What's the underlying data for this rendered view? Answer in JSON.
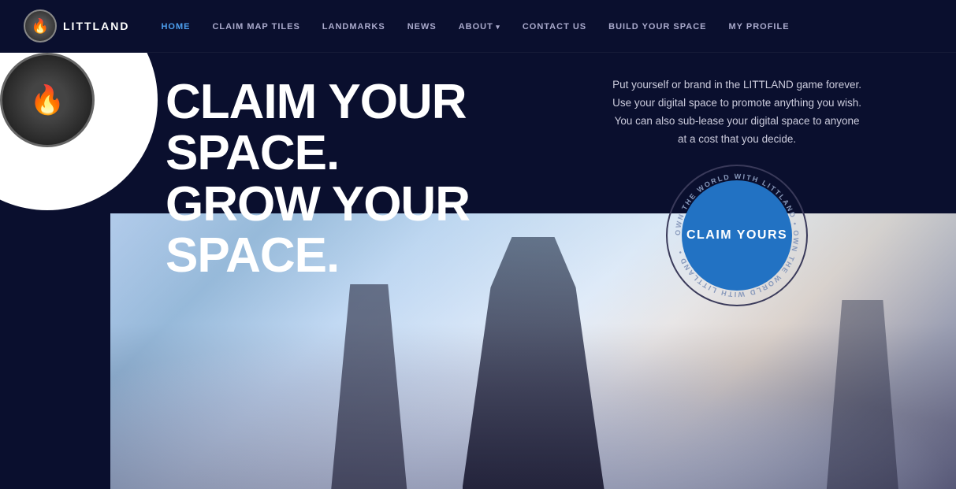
{
  "logo": {
    "text": "LITTLAND",
    "flame_icon": "🔥"
  },
  "nav": {
    "items": [
      {
        "label": "HOME",
        "active": true,
        "has_dropdown": false
      },
      {
        "label": "CLAIM MAP TILES",
        "active": false,
        "has_dropdown": false
      },
      {
        "label": "LANDMARKS",
        "active": false,
        "has_dropdown": false
      },
      {
        "label": "NEWS",
        "active": false,
        "has_dropdown": false
      },
      {
        "label": "ABOUT",
        "active": false,
        "has_dropdown": true
      },
      {
        "label": "CONTACT US",
        "active": false,
        "has_dropdown": false
      },
      {
        "label": "BUILD YOUR SPACE",
        "active": false,
        "has_dropdown": false
      },
      {
        "label": "MY PROFILE",
        "active": false,
        "has_dropdown": false
      }
    ]
  },
  "hero": {
    "headline_line1": "CLAIM YOUR SPACE.",
    "headline_line2": "GROW YOUR SPACE.",
    "description": "Put yourself or brand in the LITTLAND game forever. Use your digital space to promote anything you wish. You can also sub-lease your digital space to anyone at a cost that you decide.",
    "claim_button_label": "CLAIM YOURS",
    "ring_text": "OWN THE WORLD WITH LITTLAND • OWN THE WORLD WITH LITTLAND •"
  },
  "colors": {
    "bg": "#0a0f2e",
    "nav_active": "#4d9fef",
    "claim_blue": "#2272c3",
    "text_white": "#ffffff",
    "text_muted": "#ccccdd"
  }
}
